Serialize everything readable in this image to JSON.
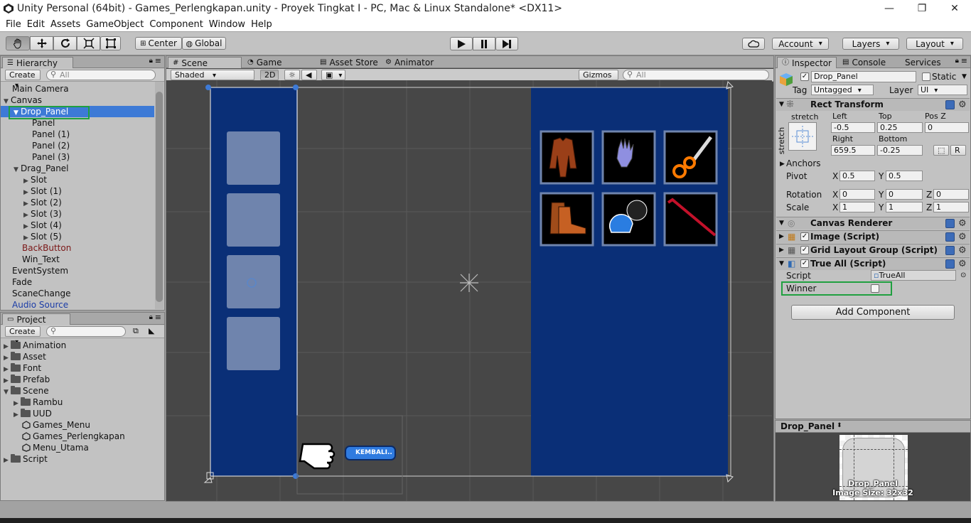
{
  "window": {
    "title": "Unity Personal (64bit) - Games_Perlengkapan.unity - Proyek Tingkat I - PC, Mac & Linux Standalone* <DX11>",
    "minimize": "—",
    "maximize": "❐",
    "close": "✕"
  },
  "menu": [
    "File",
    "Edit",
    "Assets",
    "GameObject",
    "Component",
    "Window",
    "Help"
  ],
  "toolbar": {
    "pivot": "Center",
    "space": "Global",
    "account": "Account",
    "layers": "Layers",
    "layout": "Layout"
  },
  "hierarchy": {
    "tab": "Hierarchy",
    "create": "Create",
    "search_placeholder": "All",
    "items": [
      {
        "label": "Main Camera"
      },
      {
        "label": "Canvas"
      },
      {
        "label": "Drop_Panel"
      },
      {
        "label": "Panel"
      },
      {
        "label": "Panel (1)"
      },
      {
        "label": "Panel (2)"
      },
      {
        "label": "Panel (3)"
      },
      {
        "label": "Drag_Panel"
      },
      {
        "label": "Slot"
      },
      {
        "label": "Slot (1)"
      },
      {
        "label": "Slot (2)"
      },
      {
        "label": "Slot (3)"
      },
      {
        "label": "Slot (4)"
      },
      {
        "label": "Slot (5)"
      },
      {
        "label": "BackButton"
      },
      {
        "label": "Win_Text"
      },
      {
        "label": "EventSystem"
      },
      {
        "label": "Fade"
      },
      {
        "label": "ScaneChange"
      },
      {
        "label": "Audio Source"
      }
    ]
  },
  "project": {
    "tab": "Project",
    "create": "Create",
    "items": [
      {
        "label": "Animation"
      },
      {
        "label": "Asset"
      },
      {
        "label": "Font"
      },
      {
        "label": "Prefab"
      },
      {
        "label": "Scene"
      },
      {
        "label": "Rambu"
      },
      {
        "label": "UUD"
      },
      {
        "label": "Games_Menu"
      },
      {
        "label": "Games_Perlengkapan"
      },
      {
        "label": "Menu_Utama"
      },
      {
        "label": "Script"
      }
    ]
  },
  "scene": {
    "tabs": [
      "Scene",
      "Game",
      "Asset Store",
      "Animator"
    ],
    "shading": "Shaded",
    "mode_2d": "2D",
    "gizmos": "Gizmos",
    "search_placeholder": "All",
    "back_button_text": "KEMBALI..",
    "colors": {
      "panel": "#0a2f77",
      "slot": "#6f84ad",
      "item_bg": "#000000"
    }
  },
  "inspector": {
    "tabs": [
      "Inspector",
      "Console",
      "Services"
    ],
    "object_name": "Drop_Panel",
    "static_label": "Static",
    "tag_label": "Tag",
    "tag_value": "Untagged",
    "layer_label": "Layer",
    "layer_value": "UI",
    "rect_transform": {
      "title": "Rect Transform",
      "stretch_top": "stretch",
      "stretch_side": "stretch",
      "left_label": "Left",
      "left": "-0.5",
      "top_label": "Top",
      "top": "0.25",
      "posz_label": "Pos Z",
      "posz": "0",
      "right_label": "Right",
      "right": "659.5",
      "bottom_label": "Bottom",
      "bottom": "-0.25",
      "raw_label": "R",
      "anchors_label": "Anchors",
      "pivot_label": "Pivot",
      "pivot_x": "0.5",
      "pivot_y": "0.5",
      "rotation_label": "Rotation",
      "rot_x": "0",
      "rot_y": "0",
      "rot_z": "0",
      "scale_label": "Scale",
      "scale_x": "1",
      "scale_y": "1",
      "scale_z": "1",
      "x": "X",
      "y": "Y",
      "z": "Z"
    },
    "components": {
      "canvas_renderer": "Canvas Renderer",
      "image": "Image (Script)",
      "grid": "Grid Layout Group (Script)",
      "true_all": "True All (Script)"
    },
    "script_label": "Script",
    "script_value": "TrueAll",
    "winner_label": "Winner",
    "add_component": "Add Component",
    "preview_title": "Drop_Panel",
    "preview_name": "Drop_Panel",
    "preview_size": "Image Size: 32x32"
  }
}
